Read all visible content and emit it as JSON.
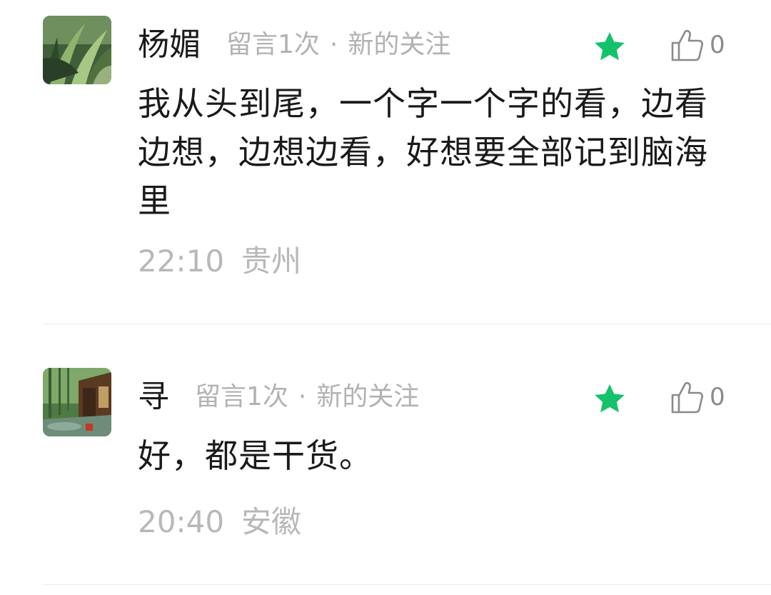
{
  "comments": [
    {
      "username": "杨媚",
      "tag_count": "留言1次",
      "tag_separator": "·",
      "tag_follow": "新的关注",
      "featured_icon": "star-icon",
      "like_icon": "thumbs-up-icon",
      "like_count": "0",
      "content": "我从头到尾，一个字一个字的看，边看边想，边想边看，好想要全部记到脑海里",
      "time": "22:10",
      "location": "贵州"
    },
    {
      "username": "寻",
      "tag_count": "留言1次",
      "tag_separator": "·",
      "tag_follow": "新的关注",
      "featured_icon": "star-icon",
      "like_icon": "thumbs-up-icon",
      "like_count": "0",
      "content": "好，都是干货。",
      "time": "20:40",
      "location": "安徽"
    }
  ],
  "colors": {
    "star": "#15c26b",
    "muted_text": "#b2b2b2",
    "divider": "#ececec"
  }
}
